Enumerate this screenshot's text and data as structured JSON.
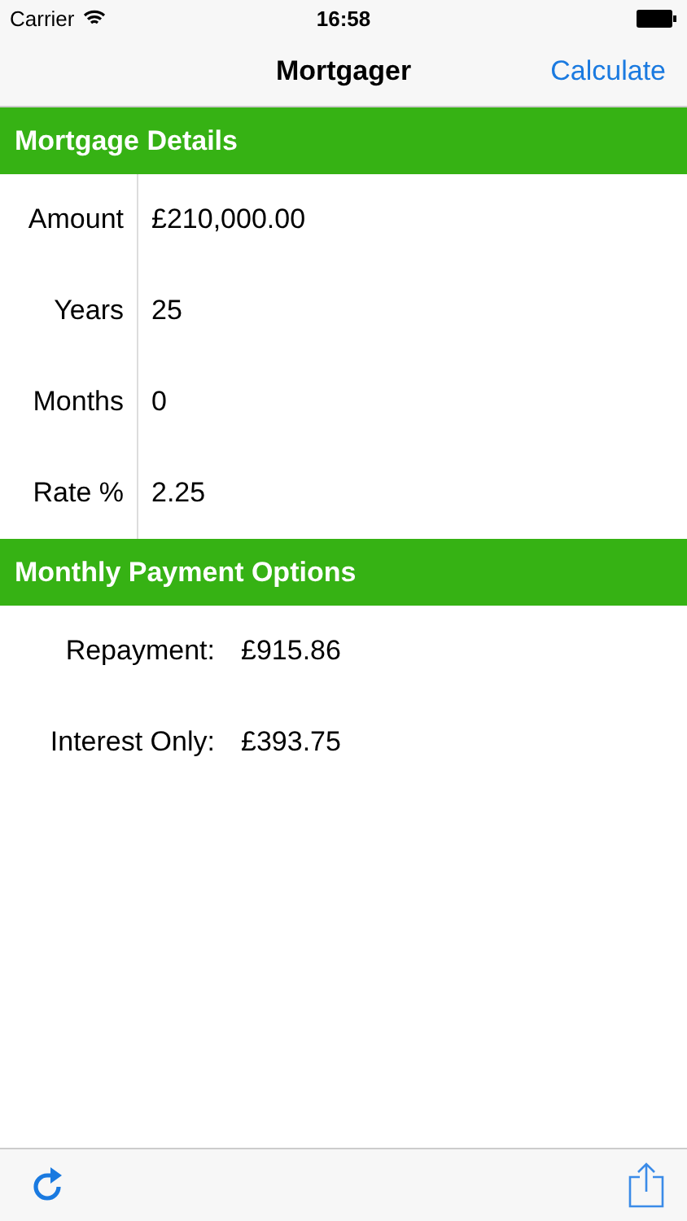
{
  "status_bar": {
    "carrier": "Carrier",
    "time": "16:58"
  },
  "nav": {
    "title": "Mortgager",
    "action": "Calculate"
  },
  "details": {
    "header": "Mortgage Details",
    "fields": [
      {
        "label": "Amount",
        "value": "£210,000.00"
      },
      {
        "label": "Years",
        "value": "25"
      },
      {
        "label": "Months",
        "value": "0"
      },
      {
        "label": "Rate %",
        "value": "2.25"
      }
    ]
  },
  "payments": {
    "header": "Monthly Payment Options",
    "rows": [
      {
        "label": "Repayment:",
        "value": "£915.86"
      },
      {
        "label": "Interest Only:",
        "value": "£393.75"
      }
    ]
  }
}
